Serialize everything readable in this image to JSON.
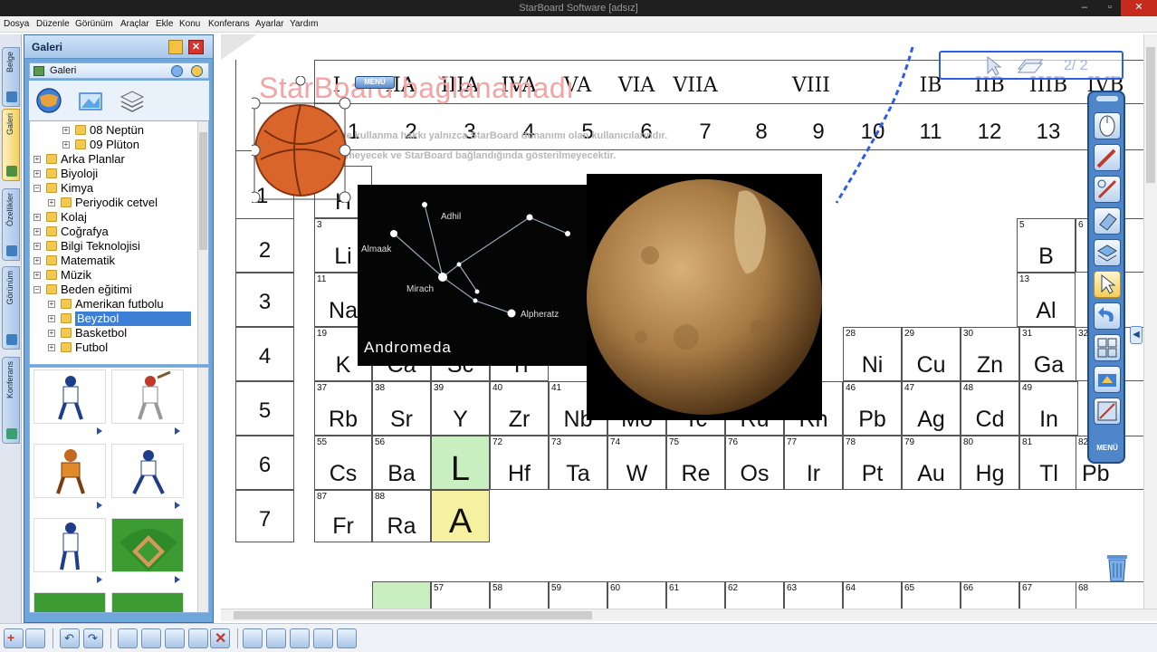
{
  "window": {
    "title": "StarBoard Software [adsız]"
  },
  "menu": [
    "Dosya",
    "Düzenle",
    "Görünüm",
    "Araçlar",
    "Ekle",
    "Konu",
    "Konferans",
    "Ayarlar",
    "Yardım"
  ],
  "side_tabs": [
    "Belge",
    "Galeri",
    "Özellikler",
    "Görünüm",
    "Konferans"
  ],
  "gallery": {
    "title": "Galeri",
    "sub_label": "Galeri",
    "tree": [
      {
        "label": "08 Neptün",
        "level": 2,
        "expanded": false
      },
      {
        "label": "09 Plüton",
        "level": 2,
        "expanded": false
      },
      {
        "label": "Arka Planlar",
        "level": 0,
        "expanded": false
      },
      {
        "label": "Biyoloji",
        "level": 0,
        "expanded": false
      },
      {
        "label": "Kimya",
        "level": 0,
        "expanded": true
      },
      {
        "label": "Periyodik cetvel",
        "level": 1,
        "expanded": false
      },
      {
        "label": "Kolaj",
        "level": 0,
        "expanded": false
      },
      {
        "label": "Coğrafya",
        "level": 0,
        "expanded": false
      },
      {
        "label": "Bilgi Teknolojisi",
        "level": 0,
        "expanded": false
      },
      {
        "label": "Matematik",
        "level": 0,
        "expanded": false
      },
      {
        "label": "Müzik",
        "level": 0,
        "expanded": false
      },
      {
        "label": "Beden eğitimi",
        "level": 0,
        "expanded": true
      },
      {
        "label": "Amerikan futbolu",
        "level": 1,
        "expanded": false
      },
      {
        "label": "Beyzbol",
        "level": 1,
        "expanded": false,
        "selected": true
      },
      {
        "label": "Basketbol",
        "level": 1,
        "expanded": false
      },
      {
        "label": "Futbol",
        "level": 1,
        "expanded": false
      }
    ]
  },
  "canvas": {
    "watermark_title": "StarBoard bağlanamadı",
    "watermark_line1": "StarBoard Software kullanma hakkı yalnızca StarBoard donanımı olan kullanıcılarındır.",
    "watermark_line2": "Bu mesaj kaydedilmeyecek ve StarBoard bağlandığında gösterilmeyecektir.",
    "menu_badge": "MENÜ",
    "roman_headers": [
      "I",
      "IIA",
      "IIIA",
      "IVA",
      "VA",
      "VIA",
      "VIIA",
      "VIII",
      "IB",
      "IIB",
      "IIIB",
      "IVB"
    ],
    "group_numbers": [
      "1",
      "2",
      "3",
      "4",
      "5",
      "6",
      "7",
      "8",
      "9",
      "10",
      "11",
      "12",
      "13"
    ],
    "periods": [
      "2",
      "3",
      "4",
      "5",
      "6",
      "7"
    ],
    "selected_label": "1",
    "andromeda": {
      "title": "Andromeda",
      "stars": [
        "Adhil",
        "Almaak",
        "Mirach",
        "Alpheratz"
      ]
    },
    "elements": [
      {
        "n": "",
        "s": "H"
      },
      {
        "n": "3",
        "s": "Li"
      },
      {
        "n": "11",
        "s": "Na"
      },
      {
        "n": "19",
        "s": "K"
      },
      {
        "n": "",
        "s": "Ca"
      },
      {
        "n": "",
        "s": "Sc"
      },
      {
        "n": "",
        "s": "Ti"
      },
      {
        "n": "37",
        "s": "Rb"
      },
      {
        "n": "38",
        "s": "Sr"
      },
      {
        "n": "39",
        "s": "Y"
      },
      {
        "n": "40",
        "s": "Zr"
      },
      {
        "n": "41",
        "s": "Nb"
      },
      {
        "n": "",
        "s": "Mo"
      },
      {
        "n": "",
        "s": "Tc"
      },
      {
        "n": "",
        "s": "Ru"
      },
      {
        "n": "",
        "s": "Rh"
      },
      {
        "n": "46",
        "s": "Pb"
      },
      {
        "n": "47",
        "s": "Ag"
      },
      {
        "n": "48",
        "s": "Cd"
      },
      {
        "n": "49",
        "s": "In"
      },
      {
        "n": "28",
        "s": "Ni"
      },
      {
        "n": "29",
        "s": "Cu"
      },
      {
        "n": "30",
        "s": "Zn"
      },
      {
        "n": "31",
        "s": "Ga"
      },
      {
        "n": "5",
        "s": "B"
      },
      {
        "n": "13",
        "s": "Al"
      },
      {
        "n": "55",
        "s": "Cs"
      },
      {
        "n": "56",
        "s": "Ba"
      },
      {
        "n": "",
        "s": "L"
      },
      {
        "n": "72",
        "s": "Hf"
      },
      {
        "n": "73",
        "s": "Ta"
      },
      {
        "n": "74",
        "s": "W"
      },
      {
        "n": "75",
        "s": "Re"
      },
      {
        "n": "76",
        "s": "Os"
      },
      {
        "n": "77",
        "s": "Ir"
      },
      {
        "n": "78",
        "s": "Pt"
      },
      {
        "n": "79",
        "s": "Au"
      },
      {
        "n": "80",
        "s": "Hg"
      },
      {
        "n": "81",
        "s": "Tl"
      },
      {
        "n": "82",
        "s": "Pb"
      },
      {
        "n": "87",
        "s": "Fr"
      },
      {
        "n": "88",
        "s": "Ra"
      },
      {
        "n": "",
        "s": "A"
      }
    ],
    "bottom_row_numbers": [
      "57",
      "58",
      "59",
      "60",
      "61",
      "62",
      "63",
      "64",
      "65",
      "66",
      "67",
      "68"
    ],
    "right_column_fragments": [
      "6",
      "32"
    ],
    "page_indicator": "2/ 2",
    "toolbar_label": "MENÜ"
  },
  "colors": {
    "lanthanide_green": "#c9efc0",
    "actinide_yellow": "#f6f1a0",
    "accent_blue": "#3d7fd6",
    "panel_blue": "#6fa7dd"
  }
}
